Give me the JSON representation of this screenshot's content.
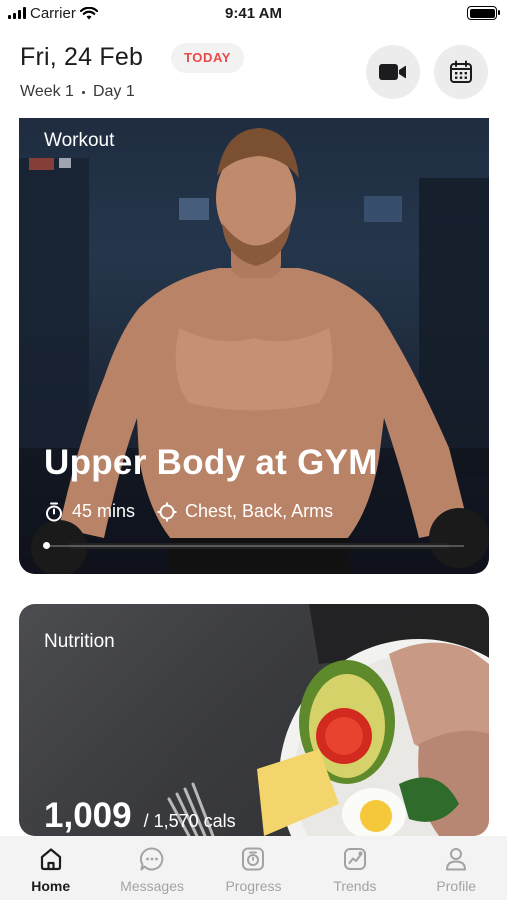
{
  "status_bar": {
    "carrier": "Carrier",
    "time": "9:41 AM"
  },
  "header": {
    "date": "Fri, 24 Feb",
    "today_badge": "TODAY",
    "week": "Week 1",
    "day": "Day 1"
  },
  "workout": {
    "label": "Workout",
    "title": "Upper Body at GYM",
    "duration": "45 mins",
    "targets": "Chest, Back, Arms",
    "progress_fraction": 0
  },
  "nutrition": {
    "label": "Nutrition",
    "calories": "1,009",
    "calories_total": "/ 1,570 cals"
  },
  "tabs": [
    {
      "label": "Home",
      "icon": "home-icon",
      "active": true
    },
    {
      "label": "Messages",
      "icon": "chat-icon",
      "active": false
    },
    {
      "label": "Progress",
      "icon": "progress-icon",
      "active": false
    },
    {
      "label": "Trends",
      "icon": "trends-icon",
      "active": false
    },
    {
      "label": "Profile",
      "icon": "profile-icon",
      "active": false
    }
  ],
  "colors": {
    "accent_red": "#e84a4a",
    "inactive_tab": "#a3a3a3",
    "active_tab": "#1c1c1e"
  }
}
